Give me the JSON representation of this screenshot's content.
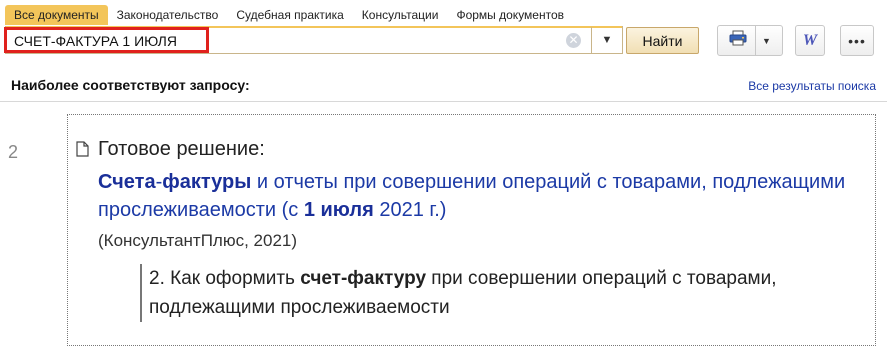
{
  "tabs": [
    {
      "label": "Все документы",
      "active": true
    },
    {
      "label": "Законодательство",
      "active": false
    },
    {
      "label": "Судебная практика",
      "active": false
    },
    {
      "label": "Консультации",
      "active": false
    },
    {
      "label": "Формы документов",
      "active": false
    }
  ],
  "search": {
    "value": "СЧЕТ-ФАКТУРА 1 ИЮЛЯ",
    "button_label": "Найти"
  },
  "toolbar": {
    "word_label": "W",
    "more_label": "•••"
  },
  "results_header": {
    "title": "Наиболее соответствуют запросу:",
    "all_results_link": "Все результаты поиска"
  },
  "result": {
    "number": "2",
    "doc_type": "Готовое решение:",
    "title_parts": [
      "Счета",
      "-",
      "фактуры",
      " и отчеты при совершении операций с товарами, подлежащими прослеживаемости (с ",
      "1 июля",
      " 2021 г.)"
    ],
    "source": "(КонсультантПлюс, 2021)",
    "snippet_parts": [
      "2. Как оформить ",
      "счет-фактуру",
      " при совершении операций с товарами, подлежащими прослеживаемости"
    ]
  },
  "colors": {
    "accent_tab": "#f3c55a",
    "highlight_frame": "#e0211d",
    "link": "#1c3aa6",
    "word_icon": "#4c56b8"
  }
}
